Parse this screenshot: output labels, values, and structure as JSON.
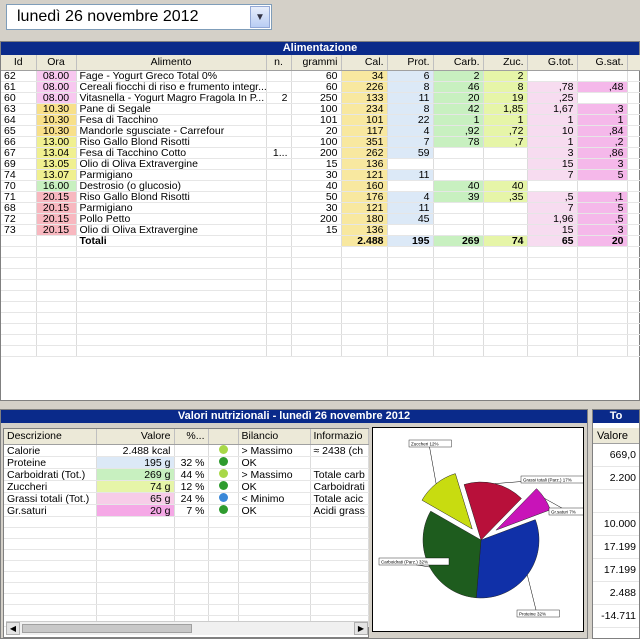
{
  "date": {
    "label": "lunedì    26 novembre 2012"
  },
  "alimentazione": {
    "title": "Alimentazione",
    "columns": [
      "Id",
      "Ora",
      "Alimento",
      "n.",
      "grammi",
      "Cal.",
      "Prot.",
      "Carb.",
      "Zuc.",
      "G.tot.",
      "G.sat."
    ],
    "rows": [
      [
        "62",
        "08.00",
        "Fage - Yogurt Greco Total 0%",
        "",
        "60",
        "34",
        "6",
        "2",
        "2",
        "",
        ""
      ],
      [
        "61",
        "08.00",
        "Cereali fiocchi di riso e frumento integr...",
        "",
        "60",
        "226",
        "8",
        "46",
        "8",
        ",78",
        ",48"
      ],
      [
        "60",
        "08.00",
        "Vitasnella - Yogurt Magro Fragola In P...",
        "2",
        "250",
        "133",
        "11",
        "20",
        "19",
        ",25",
        ""
      ],
      [
        "63",
        "10.30",
        "Pane di Segale",
        "",
        "100",
        "234",
        "8",
        "42",
        "1,85",
        "1,67",
        ",3"
      ],
      [
        "64",
        "10.30",
        "Fesa di Tacchino",
        "",
        "101",
        "101",
        "22",
        "1",
        "1",
        "1",
        "1"
      ],
      [
        "65",
        "10.30",
        "Mandorle sgusciate - Carrefour",
        "",
        "20",
        "117",
        "4",
        ",92",
        ",72",
        "10",
        ",84"
      ],
      [
        "66",
        "13.00",
        "Riso Gallo Blond Risotti",
        "",
        "100",
        "351",
        "7",
        "78",
        ",7",
        "1",
        ",2"
      ],
      [
        "67",
        "13.04",
        "Fesa di Tacchino Cotto",
        "1...",
        "200",
        "262",
        "59",
        "",
        "",
        "3",
        ",86"
      ],
      [
        "69",
        "13.05",
        "Olio di Oliva Extravergine",
        "",
        "15",
        "136",
        "",
        "",
        "",
        "15",
        "3"
      ],
      [
        "74",
        "13.07",
        "Parmigiano",
        "",
        "30",
        "121",
        "11",
        "",
        "",
        "7",
        "5"
      ],
      [
        "70",
        "16.00",
        "Destrosio (o glucosio)",
        "",
        "40",
        "160",
        "",
        "40",
        "40",
        "",
        ""
      ],
      [
        "71",
        "20.15",
        "Riso Gallo Blond Risotti",
        "",
        "50",
        "176",
        "4",
        "39",
        ",35",
        ",5",
        ",1"
      ],
      [
        "68",
        "20.15",
        "Parmigiano",
        "",
        "30",
        "121",
        "11",
        "",
        "",
        "7",
        "5"
      ],
      [
        "72",
        "20.15",
        "Pollo Petto",
        "",
        "200",
        "180",
        "45",
        "",
        "",
        "1,96",
        ",5"
      ],
      [
        "73",
        "20.15",
        "Olio di Oliva Extravergine",
        "",
        "15",
        "136",
        "",
        "",
        "",
        "15",
        "3"
      ]
    ],
    "totals": [
      "",
      "",
      "Totali",
      "",
      "",
      "2.488",
      "195",
      "269",
      "74",
      "65",
      "20"
    ]
  },
  "valori": {
    "title": "Valori nutrizionali - lunedì 26 novembre 2012",
    "columns": [
      "Descrizione",
      "Valore",
      "%...",
      "",
      "Bilancio",
      "Informazio"
    ],
    "rows": [
      {
        "desc": "Calorie",
        "val": "2.488 kcal",
        "pct": "",
        "dot": "#a8d848",
        "bil": "> Massimo",
        "info": "≈ 2438 (ch",
        "bg": ""
      },
      {
        "desc": "Proteine",
        "val": "195 g",
        "pct": "32 %",
        "dot": "#2e9b2e",
        "bil": "OK",
        "info": "",
        "bg": "#dce9f7"
      },
      {
        "desc": "Carboidrati (Tot.)",
        "val": "269 g",
        "pct": "44 %",
        "dot": "#a8d848",
        "bil": "> Massimo",
        "info": "Totale carb",
        "bg": "#c8f0c0"
      },
      {
        "desc": "Zuccheri",
        "val": "74 g",
        "pct": "12 %",
        "dot": "#2e9b2e",
        "bil": "OK",
        "info": "Carboidrati",
        "bg": "#e6f5a8"
      },
      {
        "desc": "Grassi totali (Tot.)",
        "val": "65 g",
        "pct": "24 %",
        "dot": "#3a88d8",
        "bil": "< Minimo",
        "info": "Totale acic",
        "bg": "#f7cce8"
      },
      {
        "desc": "Gr.saturi",
        "val": "20 g",
        "pct": "7 %",
        "dot": "#2e9b2e",
        "bil": "OK",
        "info": "Acidi grass",
        "bg": "#f5a8e6"
      }
    ]
  },
  "pie": {
    "slices": [
      {
        "label": "Zuccheri 12%",
        "value": 12,
        "color": "#c8dc10"
      },
      {
        "label": "Grassi totali (Parz.) 17%",
        "value": 17,
        "color": "#b8103a"
      },
      {
        "label": "Gr.saturi 7%",
        "value": 7,
        "color": "#c814b8"
      },
      {
        "label": "Proteine 32%",
        "value": 32,
        "color": "#1030a8"
      },
      {
        "label": "Carboidrati (Parz.) 32%",
        "value": 32,
        "color": "#1e5c1e"
      }
    ]
  },
  "right_panel": {
    "title": "To",
    "header": "Valore",
    "values": [
      "669,0",
      "2.200",
      "",
      "10.000",
      "17.199",
      "17.199",
      "2.488",
      "-14.711"
    ]
  }
}
